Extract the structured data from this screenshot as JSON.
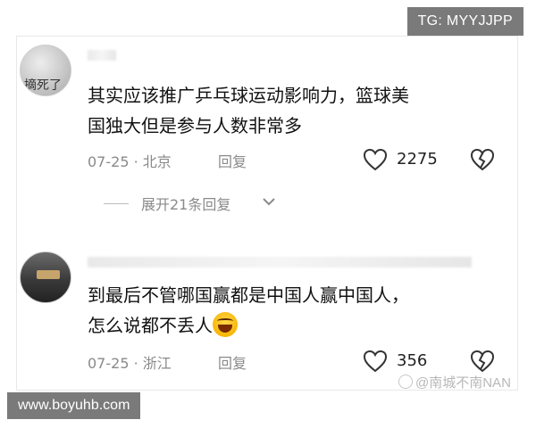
{
  "overlay": {
    "tag": "TG: MYYJJPP",
    "url": "www.boyuhb.com",
    "watermark": "@南城不南NAN"
  },
  "comments": [
    {
      "avatar_text": "摘死了",
      "text_lines": [
        "其实应该推广乒乓球运动影响力，篮球美",
        "国独大但是参与人数非常多"
      ],
      "date_location": "07-25 · 北京",
      "reply_label": "回复",
      "likes": "2275",
      "expand_label": "展开21条回复"
    },
    {
      "text_lines": [
        "到最后不管哪国赢都是中国人赢中国人，",
        "怎么说都不丢人"
      ],
      "emoji": "laughing-face",
      "date_location": "07-25 · 浙江",
      "reply_label": "回复",
      "likes": "356"
    }
  ],
  "colors": {
    "meta_gray": "#8a8a8a",
    "text_black": "#111111",
    "overlay_bg": "#7a7a7a"
  }
}
